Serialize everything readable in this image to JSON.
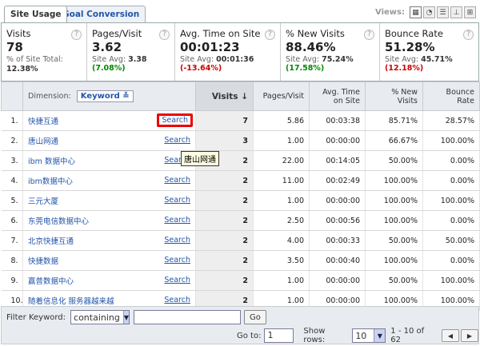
{
  "tabs": {
    "site_usage": "Site Usage",
    "goal_conversion": "Goal Conversion"
  },
  "views": {
    "label": "Views:"
  },
  "metrics": [
    {
      "title": "Visits",
      "value": "78",
      "sub_label": "% of Site Total:",
      "sub_value": "12.38%",
      "pct": ""
    },
    {
      "title": "Pages/Visit",
      "value": "3.62",
      "sub_label": "Site Avg: ",
      "sub_value": "3.38",
      "pct": "(7.08%)"
    },
    {
      "title": "Avg. Time on Site",
      "value": "00:01:23",
      "sub_label": "Site Avg: ",
      "sub_value": "00:01:36",
      "pct": "(-13.64%)"
    },
    {
      "title": "% New Visits",
      "value": "88.46%",
      "sub_label": "Site Avg: ",
      "sub_value": "75.24%",
      "pct": "(17.58%)"
    },
    {
      "title": "Bounce Rate",
      "value": "51.28%",
      "sub_label": "Site Avg: ",
      "sub_value": "45.71%",
      "pct": "(12.18%)"
    }
  ],
  "table": {
    "dimension_label": "Dimension:",
    "dimension_value": "Keyword",
    "headers": {
      "visits": "Visits",
      "pages_visit": "Pages/Visit",
      "avg_time": "Avg. Time on Site",
      "new_visits": "% New Visits",
      "bounce": "Bounce Rate"
    },
    "search_label": "Search",
    "rows": [
      {
        "n": "1.",
        "kw": "快捷互通",
        "visits": "7",
        "pv": "5.86",
        "time": "00:03:38",
        "nv": "85.71%",
        "br": "28.57%"
      },
      {
        "n": "2.",
        "kw": "唐山网通",
        "visits": "3",
        "pv": "1.00",
        "time": "00:00:00",
        "nv": "66.67%",
        "br": "100.00%"
      },
      {
        "n": "3.",
        "kw": "ibm 数据中心",
        "visits": "2",
        "pv": "22.00",
        "time": "00:14:05",
        "nv": "50.00%",
        "br": "0.00%"
      },
      {
        "n": "4.",
        "kw": "ibm数据中心",
        "visits": "2",
        "pv": "11.00",
        "time": "00:02:49",
        "nv": "100.00%",
        "br": "0.00%"
      },
      {
        "n": "5.",
        "kw": "三元大厦",
        "visits": "2",
        "pv": "1.00",
        "time": "00:00:00",
        "nv": "100.00%",
        "br": "100.00%"
      },
      {
        "n": "6.",
        "kw": "东莞电信数据中心",
        "visits": "2",
        "pv": "2.50",
        "time": "00:00:56",
        "nv": "100.00%",
        "br": "0.00%"
      },
      {
        "n": "7.",
        "kw": "北京快捷互通",
        "visits": "2",
        "pv": "4.00",
        "time": "00:00:33",
        "nv": "50.00%",
        "br": "50.00%"
      },
      {
        "n": "8.",
        "kw": "快捷数据",
        "visits": "2",
        "pv": "3.50",
        "time": "00:00:40",
        "nv": "100.00%",
        "br": "0.00%"
      },
      {
        "n": "9.",
        "kw": "赢普数据中心",
        "visits": "2",
        "pv": "1.00",
        "time": "00:00:00",
        "nv": "50.00%",
        "br": "100.00%"
      },
      {
        "n": "10.",
        "kw": "随着信息化 服务器越来越",
        "visits": "2",
        "pv": "1.00",
        "time": "00:00:00",
        "nv": "100.00%",
        "br": "100.00%"
      }
    ]
  },
  "tooltip": "唐山网通",
  "footer": {
    "filter_label": "Filter Keyword:",
    "filter_mode": "containing",
    "filter_value": "",
    "go_label": "Go",
    "goto_label": "Go to:",
    "goto_value": "1",
    "show_rows_label": "Show rows:",
    "show_rows_value": "10",
    "range": "1 - 10 of 62"
  }
}
